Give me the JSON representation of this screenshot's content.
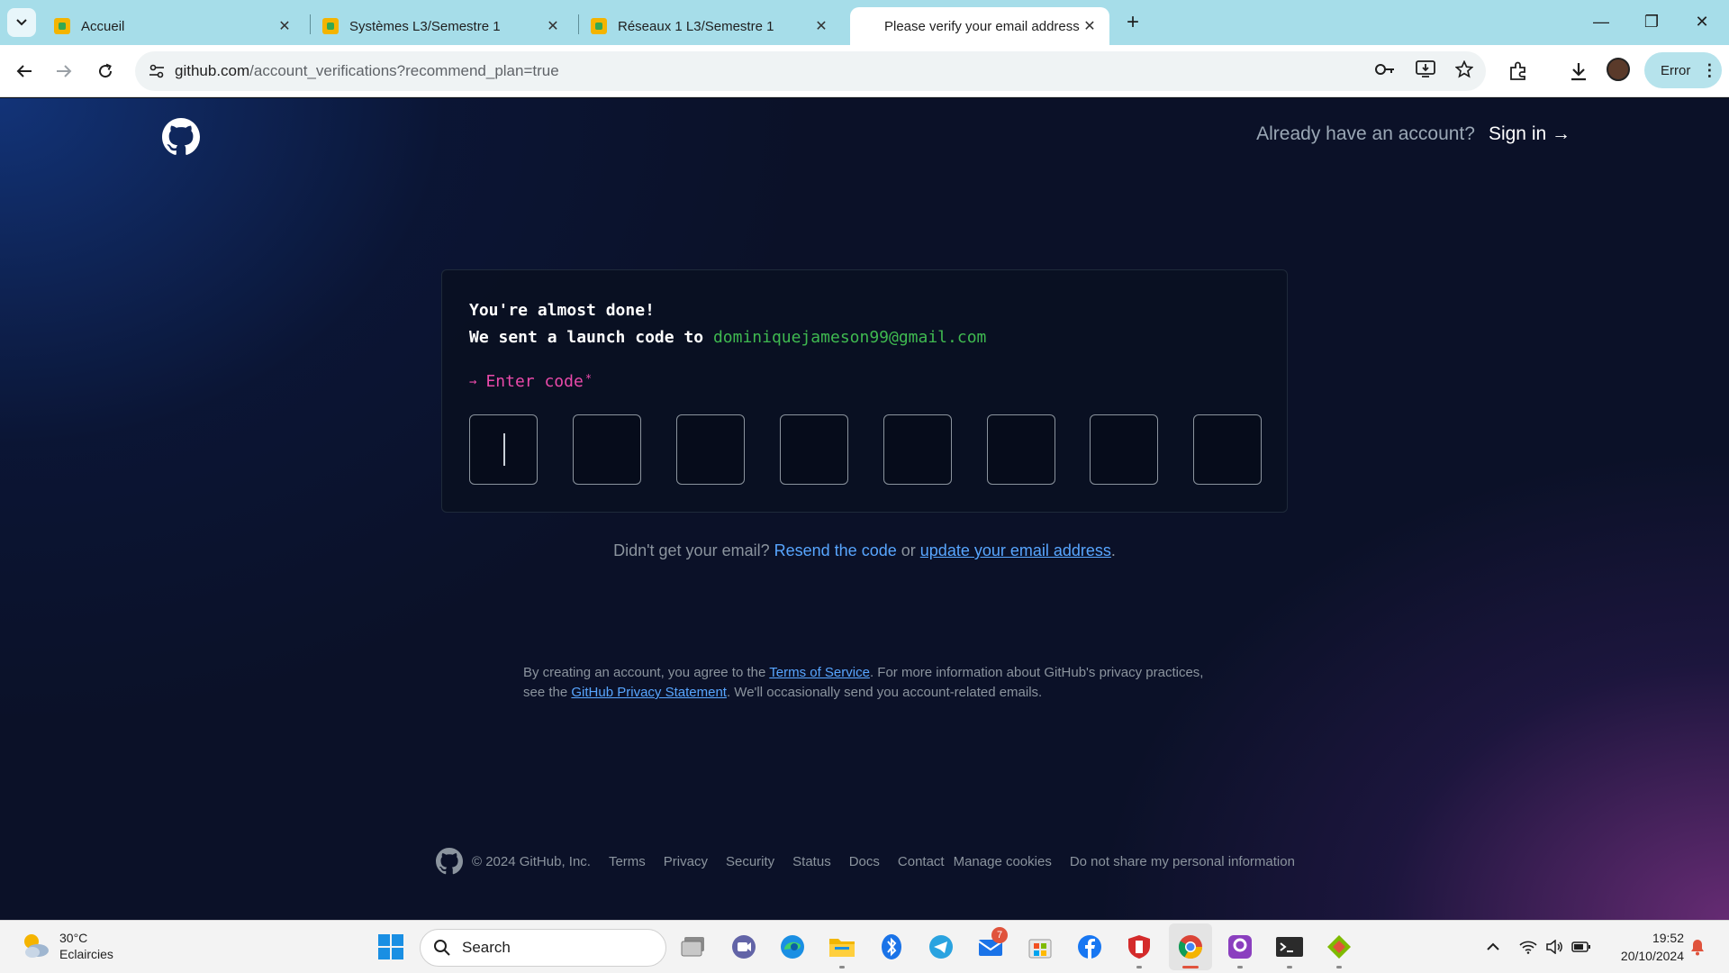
{
  "browser": {
    "tabs": [
      {
        "title": "Accueil",
        "close": "✕"
      },
      {
        "title": "Systèmes L3/Semestre 1",
        "close": "✕"
      },
      {
        "title": "Réseaux 1 L3/Semestre 1",
        "close": "✕"
      },
      {
        "title": "Please verify your email address",
        "close": "✕"
      }
    ],
    "new_tab": "+",
    "window_controls": {
      "minimize": "—",
      "restore": "❐",
      "close": "✕"
    },
    "url_host": "github.com",
    "url_path": "/account_verifications?recommend_plan=true",
    "profile_button": "Error",
    "profile_menu": "⋮"
  },
  "header": {
    "already_text": "Already have an account?",
    "signin_text": "Sign in →"
  },
  "card": {
    "line1": "You're almost done!",
    "line2_prefix": "We sent a launch code to",
    "email": "dominiquejameson99@gmail.com",
    "code_label_arrow": "→",
    "code_label": "Enter code",
    "code_required": "*",
    "code_digits": [
      "",
      "",
      "",
      "",
      "",
      "",
      "",
      ""
    ]
  },
  "resend": {
    "prefix": "Didn't get your email?",
    "resend_link": "Resend the code",
    "or": "or",
    "update_link": "update your email address",
    "suffix": "."
  },
  "legal": {
    "t1": "By creating an account, you agree to the",
    "terms_link": "Terms of Service",
    "t2": ". For more information about GitHub's privacy practices, see the",
    "privacy_link": "GitHub Privacy Statement",
    "t3": ". We'll occasionally send you account-related emails."
  },
  "footer": {
    "copyright": "© 2024 GitHub, Inc.",
    "links": [
      "Terms",
      "Privacy",
      "Security",
      "Status",
      "Docs",
      "Contact",
      "Manage cookies",
      "Do not share my personal information"
    ]
  },
  "taskbar": {
    "weather_temp": "30°C",
    "weather_desc": "Eclaircies",
    "search_label": "Search",
    "mail_badge": "7",
    "time": "19:52",
    "date": "20/10/2024"
  },
  "colors": {
    "accent_green": "#3fb950",
    "accent_pink": "#ea4aaa",
    "link_blue": "#58a6ff"
  }
}
